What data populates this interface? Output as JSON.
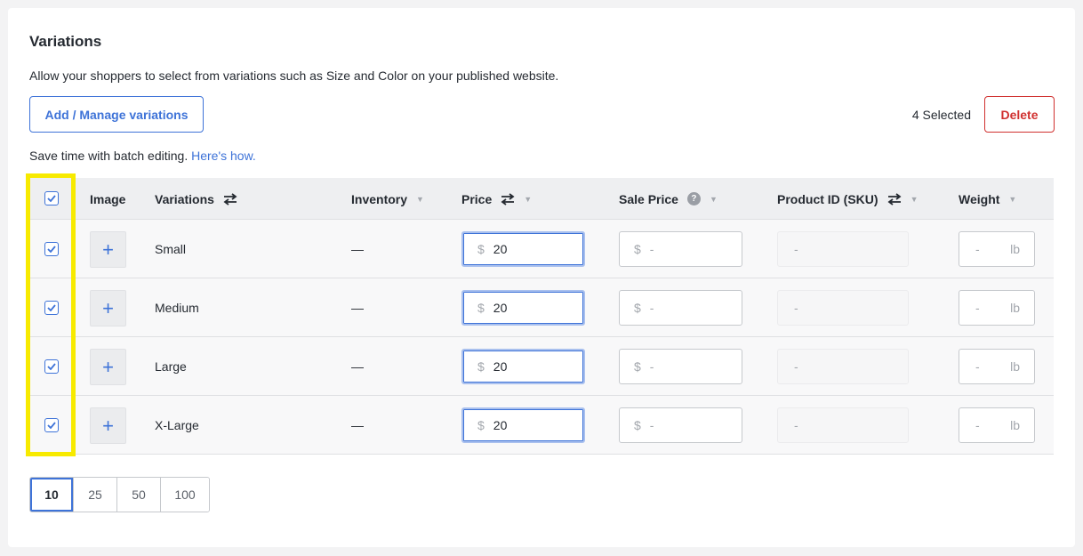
{
  "section": {
    "title": "Variations",
    "description": "Allow your shoppers to select from variations such as Size and Color on your published website.",
    "manage_button": "Add / Manage variations",
    "selected_count": "4 Selected",
    "delete_button": "Delete",
    "batch_text": "Save time with batch editing.",
    "batch_link": "Here's how."
  },
  "table": {
    "headers": {
      "image": "Image",
      "variations": "Variations",
      "inventory": "Inventory",
      "price": "Price",
      "sale_price": "Sale Price",
      "product_id": "Product ID (SKU)",
      "weight": "Weight"
    },
    "help_glyph": "?",
    "add_glyph": "+",
    "currency_symbol": "$",
    "placeholder": "-",
    "weight_unit": "lb",
    "rows": [
      {
        "name": "Small",
        "inventory": "—",
        "price": "20",
        "checked": true
      },
      {
        "name": "Medium",
        "inventory": "—",
        "price": "20",
        "checked": true
      },
      {
        "name": "Large",
        "inventory": "—",
        "price": "20",
        "checked": true
      },
      {
        "name": "X-Large",
        "inventory": "—",
        "price": "20",
        "checked": true
      }
    ]
  },
  "pagination": {
    "options": [
      "10",
      "25",
      "50",
      "100"
    ],
    "selected": "10"
  },
  "colors": {
    "accent": "#3e73d8",
    "danger": "#d0302f",
    "highlight": "#f7ea00"
  },
  "icons": {
    "sort": "swap-arrows-icon",
    "caret": "caret-down-icon",
    "help": "help-icon",
    "add": "plus-icon",
    "check": "checkmark-icon"
  }
}
